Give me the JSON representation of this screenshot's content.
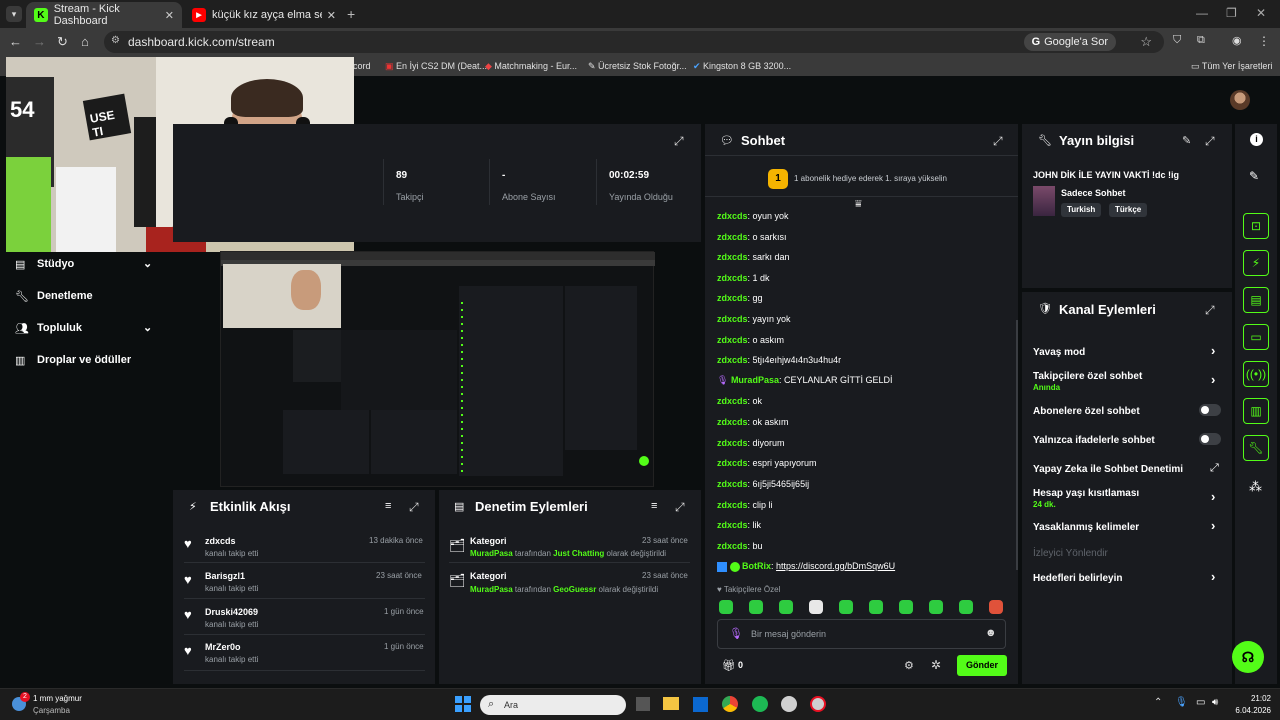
{
  "browser": {
    "tabs": [
      {
        "title": "Stream - Kick Dashboard",
        "active": true
      },
      {
        "title": "küçük kız ayça elma sekeri - Yo",
        "active": false
      }
    ],
    "url": "dashboard.kick.com/stream",
    "google_btn": "Google'a Sor",
    "bookmarks": [
      "cord",
      "En İyi CS2 DM (Deat...",
      "Matchmaking - Eur...",
      "Ücretsiz Stok Fotoğr...",
      "Kingston 8 GB 3200..."
    ],
    "bookmarks_folder": "Tüm Yer İşaretleri"
  },
  "stats": {
    "followers_value": "89",
    "followers_label": "Takipçi",
    "subs_value": "-",
    "subs_label": "Abone Sayısı",
    "live_value": "00:02:59",
    "live_label": "Yayında Olduğu"
  },
  "sidebar": {
    "items": [
      {
        "label": "Stüdyo",
        "has_chevron": true
      },
      {
        "label": "Denetleme",
        "has_chevron": false
      },
      {
        "label": "Topluluk",
        "has_chevron": true
      },
      {
        "label": "Droplar ve ödüller",
        "has_chevron": false
      }
    ]
  },
  "activity": {
    "title": "Etkinlik Akışı",
    "items": [
      {
        "name": "zdxcds",
        "sub": "kanalı takip etti",
        "time": "13 dakika önce"
      },
      {
        "name": "Barisgzl1",
        "sub": "kanalı takip etti",
        "time": "23 saat önce"
      },
      {
        "name": "Druski42069",
        "sub": "kanalı takip etti",
        "time": "1 gün önce"
      },
      {
        "name": "MrZer0o",
        "sub": "kanalı takip etti",
        "time": "1 gün önce"
      }
    ]
  },
  "moderation": {
    "title": "Denetim Eylemleri",
    "items": [
      {
        "label": "Kategori",
        "user": "MuradPasa",
        "mid": " tarafından ",
        "cat": "Just Chatting",
        "end": " olarak değiştirildi",
        "time": "23 saat önce"
      },
      {
        "label": "Kategori",
        "user": "MuradPasa",
        "mid": " tarafından ",
        "cat": "GeoGuessr",
        "end": " olarak değiştirildi",
        "time": "23 saat önce"
      }
    ]
  },
  "chat": {
    "title": "Sohbet",
    "rank_badge": "1",
    "gift_text": "1 abonelik hediye ederek 1. sıraya yükselin",
    "messages": [
      {
        "user": "zdxcds",
        "text": "oyun yok"
      },
      {
        "user": "zdxcds",
        "text": "o sarkısı"
      },
      {
        "user": "zdxcds",
        "text": "sarkı dan"
      },
      {
        "user": "zdxcds",
        "text": "1 dk"
      },
      {
        "user": "zdxcds",
        "text": "gg"
      },
      {
        "user": "zdxcds",
        "text": "yayın yok"
      },
      {
        "user": "zdxcds",
        "text": "o askım"
      },
      {
        "user": "zdxcds",
        "text": "5tjı4eıhjw4ı4n3u4hu4r"
      },
      {
        "user": "MuradPasa",
        "text": "CEYLANLAR GİTTİ GELDİ"
      },
      {
        "user": "zdxcds",
        "text": "ok"
      },
      {
        "user": "zdxcds",
        "text": "ok askım"
      },
      {
        "user": "zdxcds",
        "text": "diyorum"
      },
      {
        "user": "zdxcds",
        "text": "espri yapıyorum"
      },
      {
        "user": "zdxcds",
        "text": "6ıj5ji5465ij65ij"
      },
      {
        "user": "zdxcds",
        "text": "clip li"
      },
      {
        "user": "zdxcds",
        "text": "lik"
      },
      {
        "user": "zdxcds",
        "text": "bu"
      },
      {
        "user": "BotRix",
        "text": "https://discord.gg/bDmSqw6U"
      }
    ],
    "emote_section": "Takipçilere Özel",
    "input_placeholder": "Bir mesaj gönderin",
    "count": "0",
    "send_label": "Gönder"
  },
  "stream_info": {
    "title": "Yayın bilgisi",
    "stream_title": "JOHN DİK İLE YAYIN VAKTİ !dc !ig",
    "category": "Sadece Sohbet",
    "tags": [
      "Turkish",
      "Türkçe"
    ]
  },
  "channel_actions": {
    "title": "Kanal Eylemleri",
    "items": [
      {
        "label": "Yavaş mod",
        "sub": "",
        "control": "chevron"
      },
      {
        "label": "Takipçilere özel sohbet",
        "sub": "Anında",
        "control": "chevron"
      },
      {
        "label": "Abonelere özel sohbet",
        "sub": "",
        "control": "toggle"
      },
      {
        "label": "Yalnızca ifadelerle sohbet",
        "sub": "",
        "control": "toggle"
      },
      {
        "label": "Yapay Zeka ile Sohbet Denetimi",
        "sub": "",
        "control": "external"
      },
      {
        "label": "Hesap yaşı kısıtlaması",
        "sub": "24 dk.",
        "control": "chevron"
      },
      {
        "label": "Yasaklanmış kelimeler",
        "sub": "",
        "control": "chevron"
      },
      {
        "label": "İzleyici Yönlendir",
        "sub": "",
        "control": "disabled"
      },
      {
        "label": "Hedefleri belirleyin",
        "sub": "",
        "control": "chevron"
      }
    ]
  },
  "taskbar": {
    "weather_temp": "1 mm yağmur",
    "weather_day": "Çarşamba",
    "weather_badge": "2",
    "search": "Ara",
    "time": "21:02",
    "date": "6.04.2026"
  },
  "colors": {
    "accent": "#53fc18",
    "panel": "#191b1f",
    "bg": "#0b0e0f"
  }
}
